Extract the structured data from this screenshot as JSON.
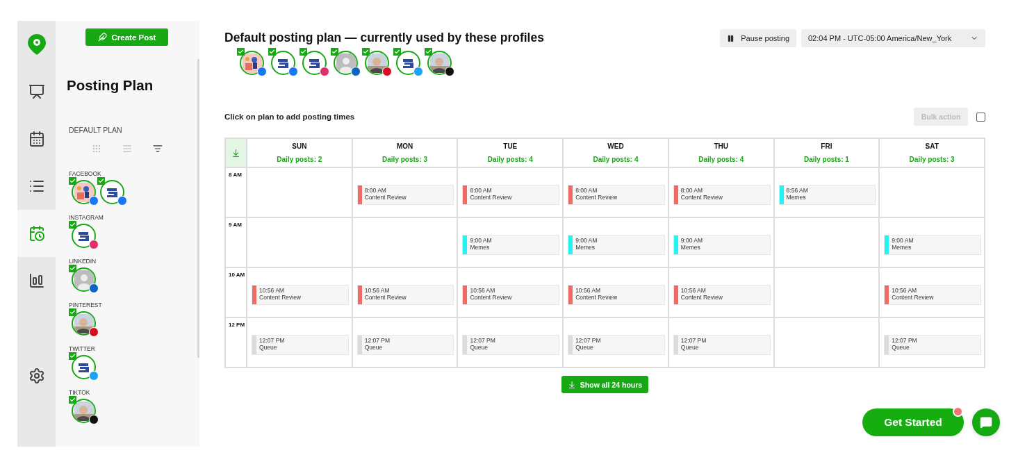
{
  "rail": [
    {
      "kind": "logo",
      "selected": false
    },
    {
      "kind": "media",
      "selected": false
    },
    {
      "kind": "calendar",
      "selected": false
    },
    {
      "kind": "list",
      "selected": false
    },
    {
      "kind": "plan",
      "selected": true
    },
    {
      "kind": "stats",
      "selected": false
    },
    {
      "kind": "settings",
      "selected": false
    }
  ],
  "sidebar": {
    "create_button": "Create Post",
    "title": "Posting Plan",
    "plan_label": "DEFAULT PLAN",
    "views": [
      {
        "kind": "grid",
        "selected": false
      },
      {
        "kind": "rows",
        "selected": false
      },
      {
        "kind": "sort",
        "selected": true
      }
    ],
    "groups": [
      {
        "label": "FACEBOOK",
        "profiles": [
          {
            "kind": "illustration",
            "color": "#1877f2",
            "checked": true
          },
          {
            "kind": "logo",
            "color": "#1877f2",
            "checked": true
          }
        ]
      },
      {
        "label": "INSTAGRAM",
        "profiles": [
          {
            "kind": "logo",
            "color": "#e1306c",
            "checked": true
          }
        ]
      },
      {
        "label": "LINKEDIN",
        "profiles": [
          {
            "kind": "default",
            "color": "#0a66c2",
            "checked": true
          }
        ]
      },
      {
        "label": "PINTEREST",
        "profiles": [
          {
            "kind": "photo",
            "color": "#d50f1f",
            "checked": true
          }
        ]
      },
      {
        "label": "TWITTER",
        "profiles": [
          {
            "kind": "logo",
            "color": "#1da1f2",
            "checked": true
          }
        ]
      },
      {
        "label": "TIKTOK",
        "profiles": [
          {
            "kind": "photo",
            "color": "#111111",
            "checked": true
          }
        ]
      }
    ]
  },
  "header": {
    "title": "Default posting plan — currently used by these profiles",
    "pause_button": "Pause posting",
    "timezone": "02:04 PM - UTC-05:00 America/New_York",
    "profiles": [
      {
        "kind": "illustration",
        "color": "#1877f2",
        "checked": true
      },
      {
        "kind": "logo",
        "color": "#1877f2",
        "checked": true
      },
      {
        "kind": "logo",
        "color": "#e1306c",
        "checked": true
      },
      {
        "kind": "default",
        "color": "#0a66c2",
        "checked": true
      },
      {
        "kind": "photo",
        "color": "#d50f1f",
        "checked": true
      },
      {
        "kind": "logo",
        "color": "#1da1f2",
        "checked": true
      },
      {
        "kind": "photo",
        "color": "#111111",
        "checked": true
      }
    ]
  },
  "toolbar": {
    "hint": "Click on plan to add posting times",
    "bulk_button": "Bulk action",
    "bulk_disabled": true,
    "select_all": false
  },
  "calendar": {
    "days": [
      {
        "name": "SUN",
        "daily": "Daily posts: 2"
      },
      {
        "name": "MON",
        "daily": "Daily posts: 3"
      },
      {
        "name": "TUE",
        "daily": "Daily posts: 4"
      },
      {
        "name": "WED",
        "daily": "Daily posts: 4"
      },
      {
        "name": "THU",
        "daily": "Daily posts: 4"
      },
      {
        "name": "FRI",
        "daily": "Daily posts: 1"
      },
      {
        "name": "SAT",
        "daily": "Daily posts: 3"
      }
    ],
    "rows": [
      {
        "time": "8 AM",
        "cells": [
          {},
          {
            "post": {
              "time": "8:00 AM",
              "label": "Content Review",
              "color": "#ee6b66"
            }
          },
          {
            "post": {
              "time": "8:00 AM",
              "label": "Content Review",
              "color": "#ee6b66"
            }
          },
          {
            "post": {
              "time": "8:00 AM",
              "label": "Content Review",
              "color": "#ee6b66"
            }
          },
          {
            "post": {
              "time": "8:00 AM",
              "label": "Content Review",
              "color": "#ee6b66"
            }
          },
          {
            "post": {
              "time": "8:56 AM",
              "label": "Memes",
              "color": "#22f4f4"
            }
          },
          {}
        ]
      },
      {
        "time": "9 AM",
        "cells": [
          {},
          {},
          {
            "post": {
              "time": "9:00 AM",
              "label": "Memes",
              "color": "#22f4f4"
            }
          },
          {
            "post": {
              "time": "9:00 AM",
              "label": "Memes",
              "color": "#22f4f4"
            }
          },
          {
            "post": {
              "time": "9:00 AM",
              "label": "Memes",
              "color": "#22f4f4"
            }
          },
          {},
          {
            "post": {
              "time": "9:00 AM",
              "label": "Memes",
              "color": "#22f4f4"
            }
          }
        ]
      },
      {
        "time": "10 AM",
        "cells": [
          {
            "post": {
              "time": "10:56 AM",
              "label": "Content Review",
              "color": "#ee6b66"
            }
          },
          {
            "post": {
              "time": "10:56 AM",
              "label": "Content Review",
              "color": "#ee6b66"
            }
          },
          {
            "post": {
              "time": "10:56 AM",
              "label": "Content Review",
              "color": "#ee6b66"
            }
          },
          {
            "post": {
              "time": "10:56 AM",
              "label": "Content Review",
              "color": "#ee6b66"
            }
          },
          {
            "post": {
              "time": "10:56 AM",
              "label": "Content Review",
              "color": "#ee6b66"
            }
          },
          {},
          {
            "post": {
              "time": "10:56 AM",
              "label": "Content Review",
              "color": "#ee6b66"
            }
          }
        ]
      },
      {
        "time": "12 PM",
        "cells": [
          {
            "post": {
              "time": "12:07 PM",
              "label": "Queue",
              "color": "#dcdcdc"
            }
          },
          {
            "post": {
              "time": "12:07 PM",
              "label": "Queue",
              "color": "#dcdcdc"
            }
          },
          {
            "post": {
              "time": "12:07 PM",
              "label": "Queue",
              "color": "#dcdcdc"
            }
          },
          {
            "post": {
              "time": "12:07 PM",
              "label": "Queue",
              "color": "#dcdcdc"
            }
          },
          {
            "post": {
              "time": "12:07 PM",
              "label": "Queue",
              "color": "#dcdcdc"
            }
          },
          {},
          {
            "post": {
              "time": "12:07 PM",
              "label": "Queue",
              "color": "#dcdcdc"
            }
          }
        ]
      }
    ],
    "show_all": "Show all 24 hours"
  },
  "footer": {
    "get_started": "Get Started",
    "notification": true
  }
}
